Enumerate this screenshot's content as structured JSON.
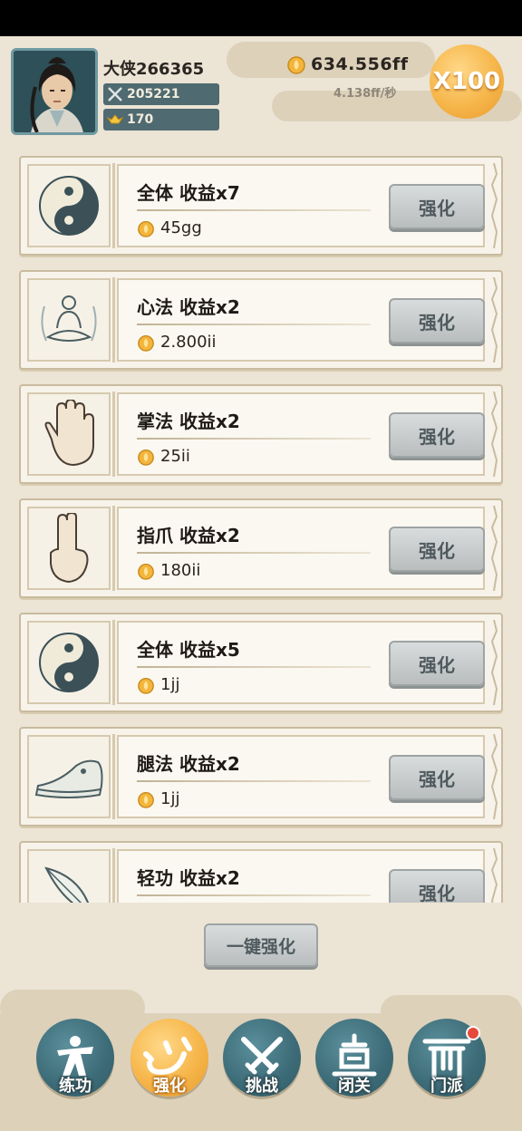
{
  "header": {
    "player_name": "大侠266365",
    "power": "205221",
    "ingots": "170",
    "coins": "634.556ff",
    "coin_rate": "4.138ff/秒",
    "multiplier": "X100"
  },
  "upgrades": [
    {
      "title": "全体 收益x7",
      "cost": "45gg",
      "button": "强化",
      "icon": "yin-yang-icon"
    },
    {
      "title": "心法 收益x2",
      "cost": "2.800ii",
      "button": "强化",
      "icon": "meditating-monk-icon"
    },
    {
      "title": "掌法 收益x2",
      "cost": "25ii",
      "button": "强化",
      "icon": "open-palm-icon"
    },
    {
      "title": "指爪 收益x2",
      "cost": "180ii",
      "button": "强化",
      "icon": "two-finger-hand-icon"
    },
    {
      "title": "全体 收益x5",
      "cost": "1jj",
      "button": "强化",
      "icon": "yin-yang-icon"
    },
    {
      "title": "腿法 收益x2",
      "cost": "1jj",
      "button": "强化",
      "icon": "cloth-shoe-icon"
    },
    {
      "title": "轻功 收益x2",
      "cost": "",
      "button": "强化",
      "icon": "feather-icon"
    }
  ],
  "one_click": "一键强化",
  "nav": [
    {
      "label": "练功",
      "icon": "martial-artist-icon",
      "active": false
    },
    {
      "label": "强化",
      "icon": "heart-calligraphy-icon",
      "active": true
    },
    {
      "label": "挑战",
      "icon": "crossed-swords-icon",
      "active": false
    },
    {
      "label": "闭关",
      "icon": "meditation-hall-icon",
      "active": false
    },
    {
      "label": "门派",
      "icon": "sect-gate-icon",
      "active": false
    }
  ],
  "colors": {
    "background": "#ece4d5",
    "accent_teal": "#3c6b77",
    "accent_gold": "#f6b64a",
    "button_gray": "#c6c9ca",
    "badge_red": "#e64a3a"
  }
}
